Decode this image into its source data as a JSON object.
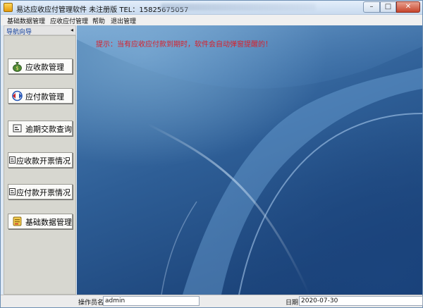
{
  "window": {
    "title": "易达应收应付管理软件 未注册版  TEL：15825675057",
    "min_label": "–",
    "max_label": "□",
    "close_label": "✕"
  },
  "menu": {
    "items": [
      "基础数据管理",
      "应收应付管理",
      "帮助",
      "退出管理"
    ]
  },
  "nav": {
    "title": "导航向导",
    "collapse_label": "◂",
    "buttons": [
      {
        "label": "应收款管理",
        "icon": "money-bag-icon"
      },
      {
        "label": "应付款管理",
        "icon": "exchange-arrows-icon"
      },
      {
        "label": "逾期交款查询",
        "icon": "report-icon"
      },
      {
        "label": "应收款开票情况",
        "icon": "report-icon"
      },
      {
        "label": "应付款开票情况",
        "icon": "report-icon"
      },
      {
        "label": "基础数据管理",
        "icon": "database-icon"
      }
    ]
  },
  "main": {
    "hint": "提示：当有应收应付款到期时，软件会自动弹窗提醒的！"
  },
  "status": {
    "operator_label": "操作员名",
    "operator_value": "admin",
    "date_label": "日期",
    "date_value": "2020-07-30"
  },
  "colors": {
    "hint": "#d8202a",
    "nav_title": "#0a3a9a",
    "desktop": "#2e5e96"
  }
}
